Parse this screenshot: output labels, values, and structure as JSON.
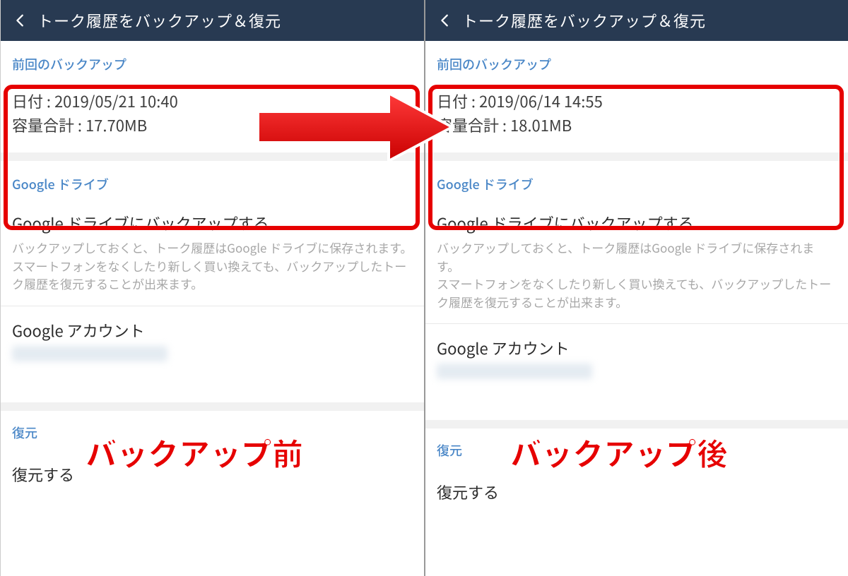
{
  "left": {
    "header_title": "トーク履歴をバックアップ＆復元",
    "backup_section_label": "前回のバックアップ",
    "date_line": "日付 : 2019/05/21 10:40",
    "size_line": "容量合計 : 17.70MB",
    "gdrive_section_label": "Google ドライブ",
    "gdrive_backup_title": "Google ドライブにバックアップする",
    "gdrive_backup_desc1": "バックアップしておくと、トーク履歴はGoogle ドライブに保存されます。",
    "gdrive_backup_desc2": "スマートフォンをなくしたり新しく買い換えても、バックアップしたトーク履歴を復元することが出来ます。",
    "gaccount_label": "Google アカウント",
    "restore_section_label": "復元",
    "restore_action": "復元する",
    "annotation": "バックアップ前"
  },
  "right": {
    "header_title": "トーク履歴をバックアップ＆復元",
    "backup_section_label": "前回のバックアップ",
    "date_line": "日付 : 2019/06/14 14:55",
    "size_line": "容量合計 : 18.01MB",
    "gdrive_section_label": "Google ドライブ",
    "gdrive_backup_title": "Google ドライブにバックアップする",
    "gdrive_backup_desc1": "バックアップしておくと、トーク履歴はGoogle ドライブに保存されます。",
    "gdrive_backup_desc2": "スマートフォンをなくしたり新しく買い換えても、バックアップしたトーク履歴を復元することが出来ます。",
    "gaccount_label": "Google アカウント",
    "restore_section_label": "復元",
    "restore_action": "復元する",
    "annotation": "バックアップ後"
  }
}
